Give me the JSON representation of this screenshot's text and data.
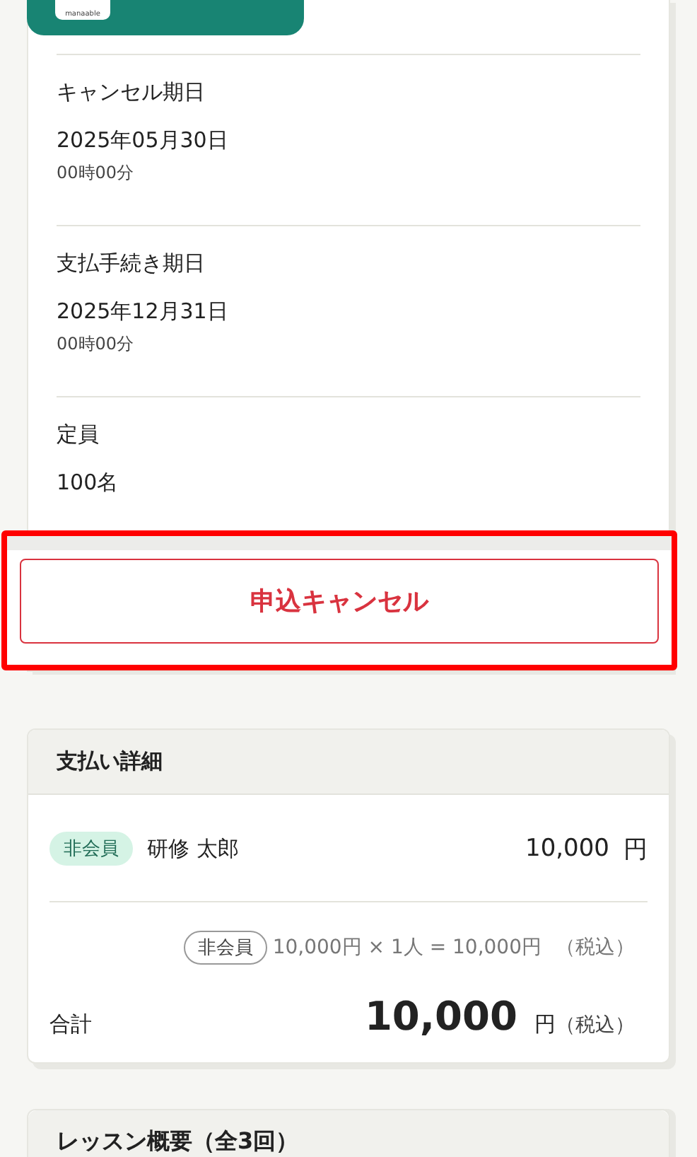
{
  "banner": {
    "logo_text": "manaable"
  },
  "details": [
    {
      "label": "キャンセル期日",
      "value": "2025年05月30日",
      "time": "00時00分"
    },
    {
      "label": "支払手続き期日",
      "value": "2025年12月31日",
      "time": "00時00分"
    },
    {
      "label": "定員",
      "value": "100名"
    }
  ],
  "cancel_button": "申込キャンセル",
  "payment": {
    "title": "支払い詳細",
    "participant": {
      "badge": "非会員",
      "name": "研修 太郎",
      "amount": "10,000",
      "unit": "円"
    },
    "breakdown": {
      "badge": "非会員",
      "formula": "10,000円 × 1人 = 10,000円",
      "tax": "（税込）"
    },
    "total": {
      "label": "合計",
      "amount": "10,000",
      "unit": "円",
      "tax": "（税込）"
    }
  },
  "lesson": {
    "title": "レッスン概要（全3回）"
  }
}
